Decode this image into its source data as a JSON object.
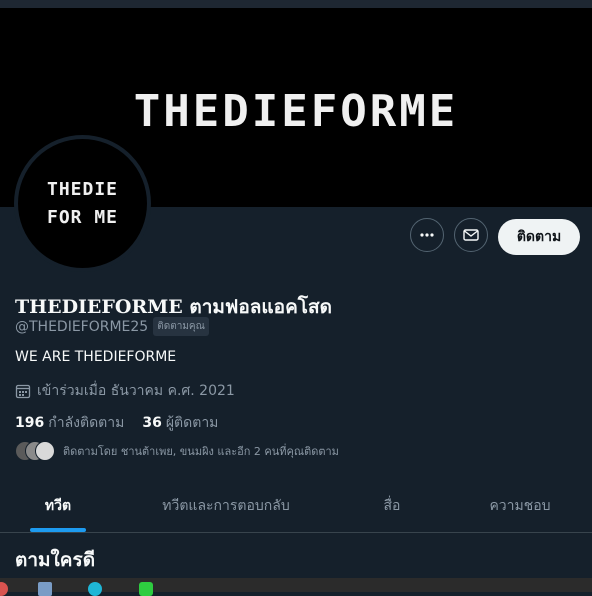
{
  "banner": {
    "logo_text": "THEDIEFORME"
  },
  "avatar": {
    "line1": "THEDIE",
    "line2": "FOR ME"
  },
  "actions": {
    "follow_label": "ติดตาม"
  },
  "profile": {
    "display_name": "THEDIEFORME ตามฟอลแอคโสด",
    "handle": "@THEDIEFORME25",
    "follows_you_badge": "ติดตามคุณ",
    "bio": "WE ARE THEDIEFORME",
    "joined": "เข้าร่วมเมื่อ ธันวาคม ค.ศ. 2021",
    "following_count": "196",
    "following_label": "กำลังติดตาม",
    "followers_count": "36",
    "followers_label": "ผู้ติดตาม",
    "followed_by": "ติดตามโดย ชานต้าเพย, ขนมผิง และอีก 2 คนที่คุณติดตาม"
  },
  "tabs": [
    {
      "label": "ทวีต",
      "active": true
    },
    {
      "label": "ทวีตและการตอบกลับ",
      "active": false
    },
    {
      "label": "สื่อ",
      "active": false
    },
    {
      "label": "ความชอบ",
      "active": false
    }
  ],
  "sections": {
    "who_to_follow": "ตามใครดี"
  },
  "colors": {
    "accent": "#1d9bf0",
    "background": "#15202b",
    "follow_button_bg": "#eff3f4"
  },
  "icons": [
    "more-icon",
    "mail-icon",
    "calendar-icon"
  ]
}
